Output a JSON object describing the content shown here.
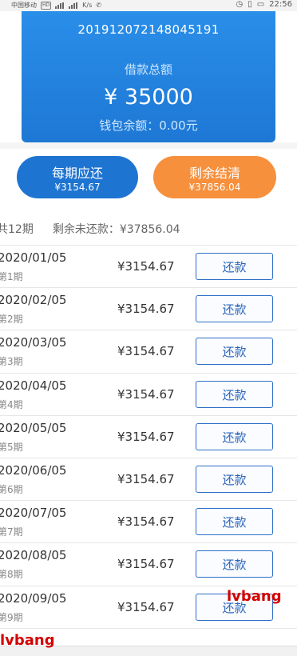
{
  "status_bar": {
    "carrier": "中国移动",
    "network_badge": "HD",
    "speed": "K/s",
    "time": "22:56"
  },
  "header": {
    "order_number": "201912072148045191",
    "loan_label": "借款总额",
    "loan_amount": "¥ 35000",
    "wallet_balance": "钱包余额：0.00元"
  },
  "actions": {
    "per_period": {
      "label": "每期应还",
      "amount": "¥3154.67"
    },
    "settle_remaining": {
      "label": "剩余结清",
      "amount": "¥37856.04"
    }
  },
  "summary": {
    "total_periods": "共12期",
    "remaining_unpaid": "剩余未还款：¥37856.04"
  },
  "installments": [
    {
      "date": "2020/01/05",
      "period": "第1期",
      "amount": "¥3154.67",
      "button": "还款"
    },
    {
      "date": "2020/02/05",
      "period": "第2期",
      "amount": "¥3154.67",
      "button": "还款"
    },
    {
      "date": "2020/03/05",
      "period": "第3期",
      "amount": "¥3154.67",
      "button": "还款"
    },
    {
      "date": "2020/04/05",
      "period": "第4期",
      "amount": "¥3154.67",
      "button": "还款"
    },
    {
      "date": "2020/05/05",
      "period": "第5期",
      "amount": "¥3154.67",
      "button": "还款"
    },
    {
      "date": "2020/06/05",
      "period": "第6期",
      "amount": "¥3154.67",
      "button": "还款"
    },
    {
      "date": "2020/07/05",
      "period": "第7期",
      "amount": "¥3154.67",
      "button": "还款"
    },
    {
      "date": "2020/08/05",
      "period": "第8期",
      "amount": "¥3154.67",
      "button": "还款"
    },
    {
      "date": "2020/09/05",
      "period": "第9期",
      "amount": "¥3154.67",
      "button": "还款"
    }
  ],
  "watermarks": [
    "lvbang",
    "lvbang"
  ],
  "colors": {
    "header_blue": "#1d78d4",
    "per_period_button": "#1e74d1",
    "settle_button": "#f6903d",
    "repay_border": "#2d6fc6",
    "watermark": "#d40000"
  }
}
